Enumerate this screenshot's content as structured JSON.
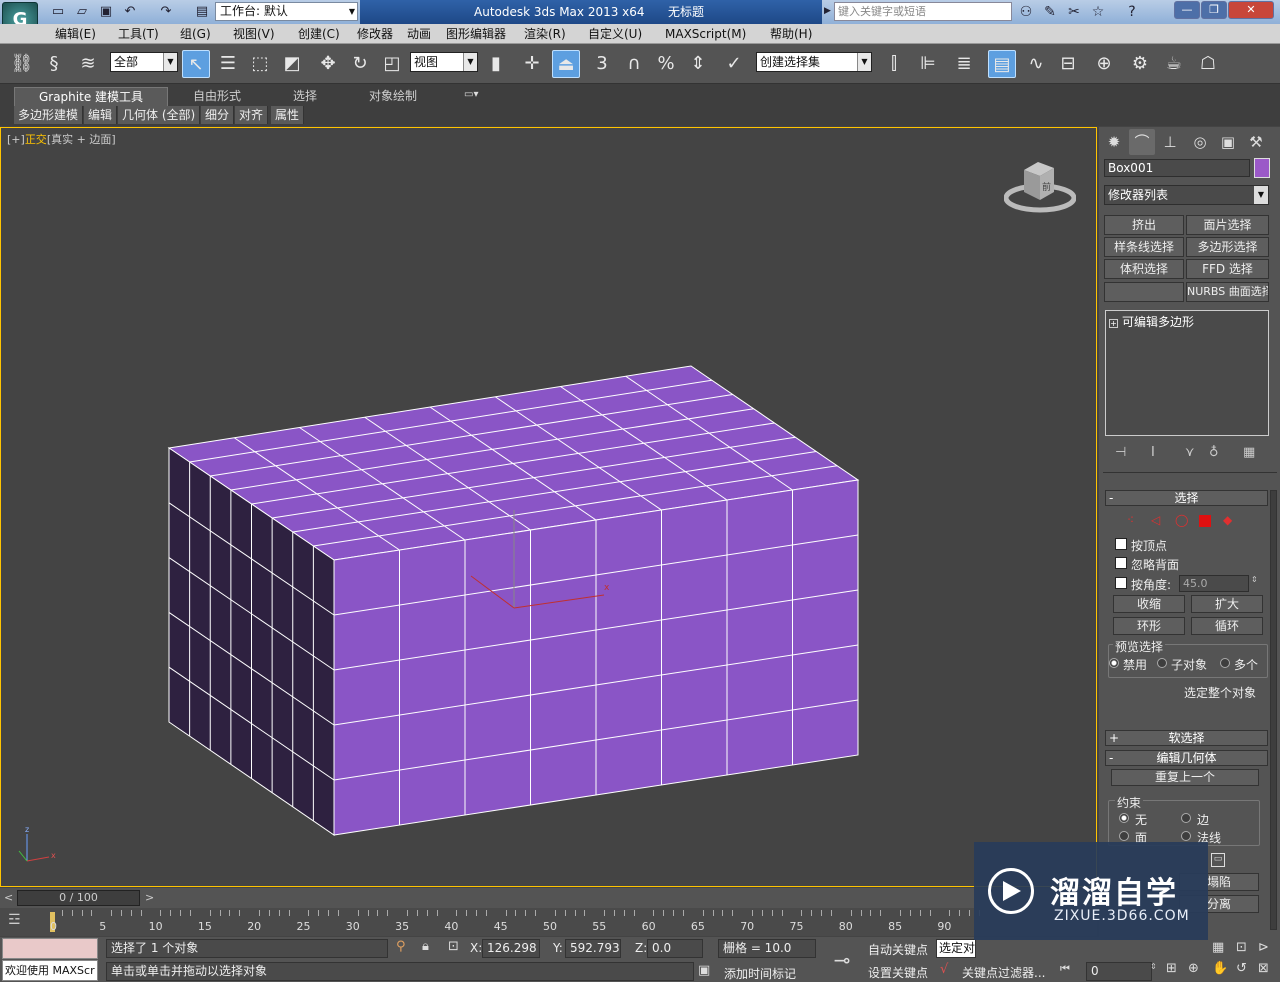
{
  "titlebar": {
    "workspace": "工作台: 默认",
    "app_title": "Autodesk 3ds Max  2013 x64",
    "doc_title": "无标题",
    "search_placeholder": "键入关键字或短语"
  },
  "menu": [
    "编辑(E)",
    "工具(T)",
    "组(G)",
    "视图(V)",
    "创建(C)",
    "修改器",
    "动画",
    "图形编辑器",
    "渲染(R)",
    "自定义(U)",
    "MAXScript(M)",
    "帮助(H)"
  ],
  "toolbar": {
    "filter_value": "全部",
    "ref_coord_value": "视图",
    "snap_angle_label": "3",
    "named_sel_value": "创建选择集"
  },
  "ribbon": {
    "tabs": [
      "Graphite 建模工具",
      "自由形式",
      "选择",
      "对象绘制"
    ],
    "subtabs": [
      "多边形建模",
      "编辑",
      "几何体 (全部)",
      "细分",
      "对齐",
      "属性"
    ]
  },
  "viewport": {
    "label_plus": "[+]",
    "label_view": "正交",
    "label_shading": "[真实 + 边面]",
    "viewcube_face": "前",
    "object_color": "#8a55c6"
  },
  "cmdpanel": {
    "object_name": "Box001",
    "object_color": "#9b59c8",
    "modifier_list": "修改器列表",
    "mod_buttons": [
      "挤出",
      "面片选择",
      "样条线选择",
      "多边形选择",
      "体积选择",
      "FFD 选择",
      "",
      "NURBS 曲面选择"
    ],
    "stack_item": "可编辑多边形",
    "selection": {
      "title": "选择",
      "by_vertex": "按顶点",
      "ignore_backfacing": "忽略背面",
      "by_angle": "按角度:",
      "angle_value": "45.0",
      "shrink": "收缩",
      "grow": "扩大",
      "ring": "环形",
      "loop": "循环",
      "preview_title": "预览选择",
      "preview_off": "禁用",
      "preview_sub": "子对象",
      "preview_multi": "多个",
      "select_whole": "选定整个对象"
    },
    "soft_selection": "软选择",
    "edit_geometry": "编辑几何体",
    "repeat_last": "重复上一个",
    "constraints": {
      "title": "约束",
      "none": "无",
      "edge": "边",
      "face": "面",
      "normal": "法线"
    },
    "collapse": "塌陷",
    "detach": "分离"
  },
  "timeline": {
    "frame_display": "0 / 100",
    "ticks": [
      "0",
      "5",
      "10",
      "15",
      "20",
      "25",
      "30",
      "35",
      "40",
      "45",
      "50",
      "55",
      "60",
      "65",
      "70",
      "75",
      "80",
      "85",
      "90"
    ]
  },
  "statusbar": {
    "welcome": "欢迎使用 MAXScr",
    "selected": "选择了 1 个对象",
    "prompt": "单击或单击并拖动以选择对象",
    "x_label": "X:",
    "x_value": "126.298",
    "y_label": "Y:",
    "y_value": "592.793",
    "z_label": "Z:",
    "z_value": "0.0",
    "grid": "栅格 = 10.0",
    "add_time_tag": "添加时间标记",
    "auto_key": "自动关键点",
    "set_key": "设置关键点",
    "selected_dropdown": "选定对",
    "key_filters": "关键点过滤器...",
    "frame_value": "0"
  },
  "watermark": {
    "title": "溜溜自学",
    "url": "ZIXUE.3D66.COM"
  }
}
